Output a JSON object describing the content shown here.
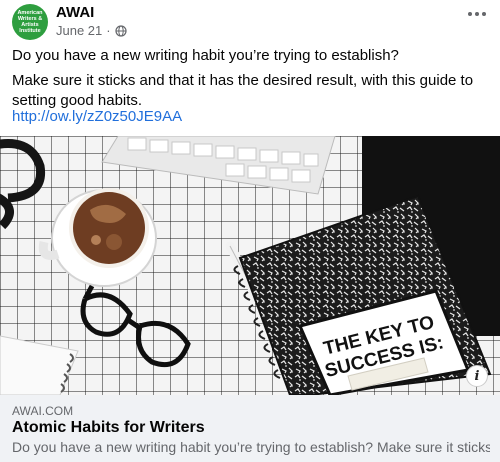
{
  "page": {
    "name": "AWAI",
    "avatar_text": "American Writers & Artists Institute",
    "date": "June 21",
    "privacy_icon": "globe-icon",
    "more_icon": "more-options-icon"
  },
  "post": {
    "line1": "Do you have a new writing habit you’re trying to establish?",
    "line2": "Make sure it sticks and that it has the desired result, with this guide to setting good habits.",
    "link": "http://ow.ly/zZ0z50JE9AA"
  },
  "image": {
    "notebook_line1": "THE KEY TO",
    "notebook_line2": "SUCCESS IS:"
  },
  "preview": {
    "domain": "AWAI.COM",
    "title": "Atomic Habits for Writers",
    "description": "Do you have a new writing habit you’re trying to establish? Make sure it sticks an..."
  },
  "colors": {
    "avatar_green": "#2e9e3f",
    "link_blue": "#216fdb",
    "preview_bg": "#f0f2f5"
  }
}
